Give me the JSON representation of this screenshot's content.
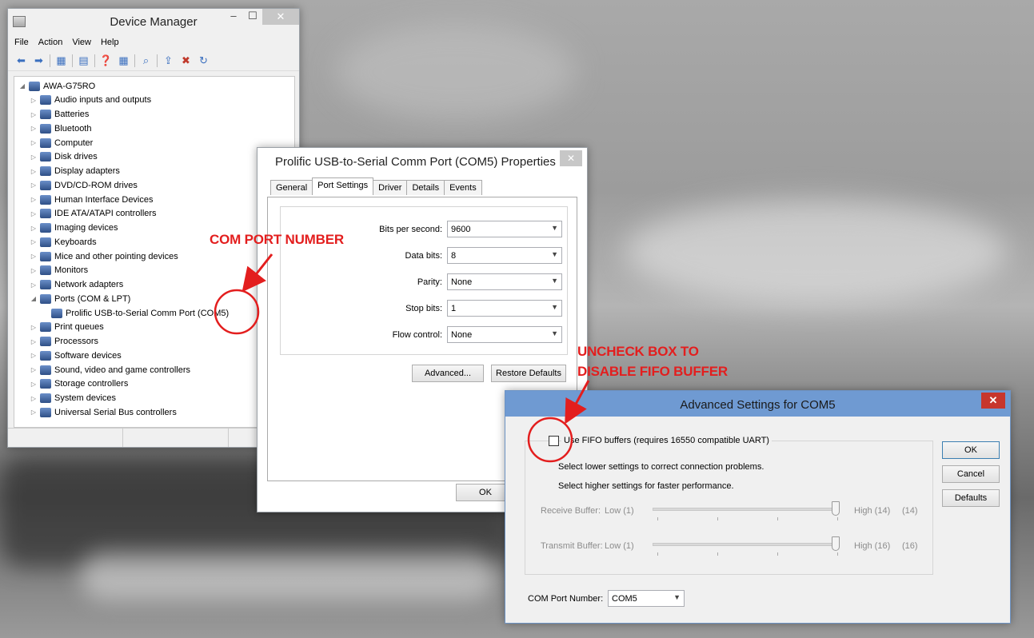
{
  "device_manager": {
    "title": "Device Manager",
    "menu": [
      "File",
      "Action",
      "View",
      "Help"
    ],
    "tree": [
      {
        "label": "AWA-G75RO",
        "expander": "◢",
        "level": 0
      },
      {
        "label": "Audio inputs and outputs",
        "expander": "▷",
        "level": 1
      },
      {
        "label": "Batteries",
        "expander": "▷",
        "level": 1
      },
      {
        "label": "Bluetooth",
        "expander": "▷",
        "level": 1
      },
      {
        "label": "Computer",
        "expander": "▷",
        "level": 1
      },
      {
        "label": "Disk drives",
        "expander": "▷",
        "level": 1
      },
      {
        "label": "Display adapters",
        "expander": "▷",
        "level": 1
      },
      {
        "label": "DVD/CD-ROM drives",
        "expander": "▷",
        "level": 1
      },
      {
        "label": "Human Interface Devices",
        "expander": "▷",
        "level": 1
      },
      {
        "label": "IDE ATA/ATAPI controllers",
        "expander": "▷",
        "level": 1
      },
      {
        "label": "Imaging devices",
        "expander": "▷",
        "level": 1
      },
      {
        "label": "Keyboards",
        "expander": "▷",
        "level": 1
      },
      {
        "label": "Mice and other pointing devices",
        "expander": "▷",
        "level": 1
      },
      {
        "label": "Monitors",
        "expander": "▷",
        "level": 1
      },
      {
        "label": "Network adapters",
        "expander": "▷",
        "level": 1
      },
      {
        "label": "Ports (COM & LPT)",
        "expander": "◢",
        "level": 1
      },
      {
        "label": "Prolific USB-to-Serial Comm Port (COM5)",
        "expander": "",
        "level": 2
      },
      {
        "label": "Print queues",
        "expander": "▷",
        "level": 1
      },
      {
        "label": "Processors",
        "expander": "▷",
        "level": 1
      },
      {
        "label": "Software devices",
        "expander": "▷",
        "level": 1
      },
      {
        "label": "Sound, video and game controllers",
        "expander": "▷",
        "level": 1
      },
      {
        "label": "Storage controllers",
        "expander": "▷",
        "level": 1
      },
      {
        "label": "System devices",
        "expander": "▷",
        "level": 1
      },
      {
        "label": "Universal Serial Bus controllers",
        "expander": "▷",
        "level": 1
      }
    ]
  },
  "properties": {
    "title": "Prolific USB-to-Serial Comm Port (COM5) Properties",
    "close_glyph": "✕",
    "tabs": [
      "General",
      "Port Settings",
      "Driver",
      "Details",
      "Events"
    ],
    "active_tab": "Port Settings",
    "fields": [
      {
        "label": "Bits per second:",
        "value": "9600"
      },
      {
        "label": "Data bits:",
        "value": "8"
      },
      {
        "label": "Parity:",
        "value": "None"
      },
      {
        "label": "Stop bits:",
        "value": "1"
      },
      {
        "label": "Flow control:",
        "value": "None"
      }
    ],
    "advanced_label": "Advanced...",
    "restore_label": "Restore Defaults",
    "ok_label": "OK"
  },
  "advanced": {
    "title": "Advanced Settings for COM5",
    "close_glyph": "✕",
    "fifo_checkbox_label": "Use FIFO buffers (requires 16550 compatible UART)",
    "fifo_checked": false,
    "hint_lower": "Select lower settings to correct connection problems.",
    "hint_higher": "Select higher settings for faster performance.",
    "receive": {
      "label": "Receive Buffer:",
      "low": "Low (1)",
      "high": "High (14)",
      "value_text": "(14)"
    },
    "transmit": {
      "label": "Transmit Buffer:",
      "low": "Low (1)",
      "high": "High (16)",
      "value_text": "(16)"
    },
    "ok_label": "OK",
    "cancel_label": "Cancel",
    "defaults_label": "Defaults",
    "com_port_label": "COM Port Number:",
    "com_port_value": "COM5"
  },
  "annotations": {
    "com_port": "COM PORT NUMBER",
    "uncheck_line1": "UNCHECK BOX TO",
    "uncheck_line2": "DISABLE FIFO BUFFER"
  },
  "colors": {
    "annotation": "#e31e1e",
    "adv_titlebar": "#6f9ad2"
  }
}
